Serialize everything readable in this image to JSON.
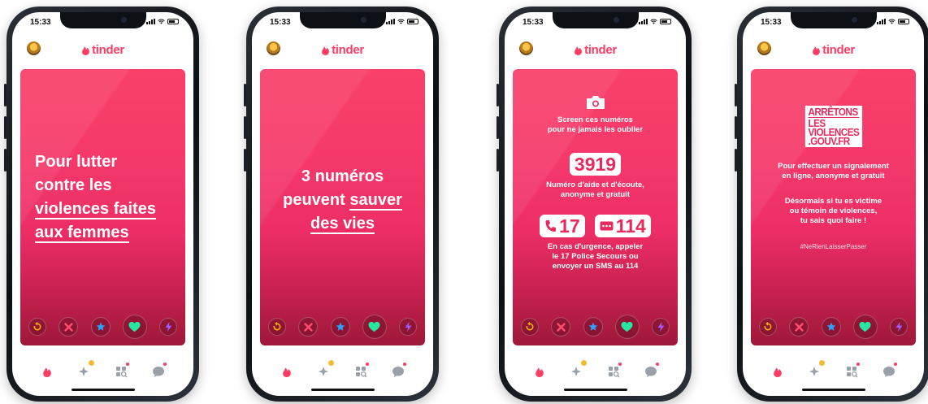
{
  "status_time": "15:33",
  "app_name": "tinder",
  "colors": {
    "brand": "#fd3b63",
    "card_top": "#f9406b",
    "card_bottom": "#9e1838",
    "badge_gold": "#f1bb34"
  },
  "phones": [
    {
      "card": {
        "line1": "Pour lutter",
        "line2": "contre les",
        "line3": "violences faites",
        "line4": "aux femmes"
      }
    },
    {
      "card": {
        "line1": "3 numéros",
        "line2_a": "peuvent ",
        "line2_b": "sauver",
        "line3": "des vies"
      }
    },
    {
      "card": {
        "hint_line1": "Screen ces numéros",
        "hint_line2": "pour ne jamais les oublier",
        "number_main": "3919",
        "desc_line1": "Numéro d'aide et d'écoute,",
        "desc_line2": "anonyme et gratuit",
        "number_police": "17",
        "number_sms": "114",
        "urgence_line1": "En cas d'urgence, appeler",
        "urgence_line2": "le 17 Police Secours ou",
        "urgence_line3": "envoyer un SMS au 114"
      }
    },
    {
      "card": {
        "gov_l1": "ARRÊTONS",
        "gov_l2": "LES",
        "gov_l3": "VIOLENCES",
        "gov_l4": ".GOUV.FR",
        "report_line1": "Pour effectuer un signalement",
        "report_line2": "en ligne, anonyme et gratuit",
        "victim_line1": "Désormais si tu es victime",
        "victim_line2": "ou témoin de violences,",
        "victim_line3": "tu sais quoi faire !",
        "hashtag": "#NeRienLaisserPasser"
      }
    }
  ],
  "action_buttons": [
    "rewind-icon",
    "nope-icon",
    "super-like-icon",
    "like-icon",
    "boost-icon"
  ],
  "nav_items": [
    "home-flame-icon",
    "gold-sparkle-icon",
    "explore-icon",
    "messages-icon"
  ]
}
